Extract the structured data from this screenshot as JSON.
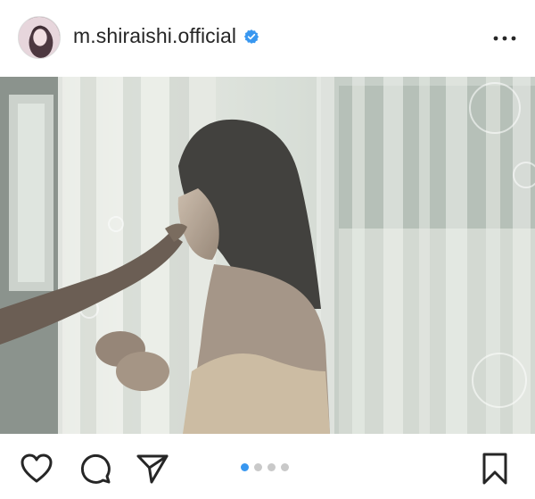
{
  "profile": {
    "username": "m.shiraishi.official",
    "verified": true,
    "avatar_icon": "profile-avatar"
  },
  "header": {
    "more_icon": "more-options-icon"
  },
  "post": {
    "image_icon": "post-photo",
    "carousel": {
      "total": 4,
      "active_index": 0
    }
  },
  "actions": {
    "like_icon": "heart-icon",
    "comment_icon": "comment-icon",
    "share_icon": "send-icon",
    "save_icon": "bookmark-icon"
  },
  "colors": {
    "accent": "#3897f0",
    "text": "#262626",
    "dot_inactive": "#c9c9c9"
  }
}
